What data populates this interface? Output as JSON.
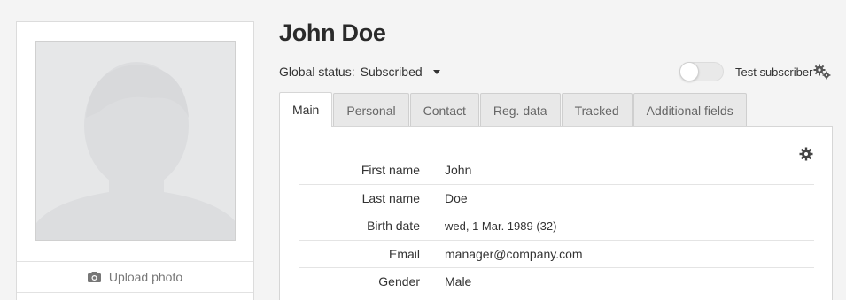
{
  "profile": {
    "name": "John Doe",
    "upload_label": "Upload photo"
  },
  "status": {
    "label": "Global status:",
    "value": "Subscribed"
  },
  "test_subscriber": {
    "label": "Test subscriber",
    "enabled": false
  },
  "tabs": [
    {
      "label": "Main",
      "active": true
    },
    {
      "label": "Personal",
      "active": false
    },
    {
      "label": "Contact",
      "active": false
    },
    {
      "label": "Reg. data",
      "active": false
    },
    {
      "label": "Tracked",
      "active": false
    },
    {
      "label": "Additional fields",
      "active": false
    }
  ],
  "fields": [
    {
      "label": "First name",
      "value": "John"
    },
    {
      "label": "Last name",
      "value": "Doe"
    },
    {
      "label": "Birth date",
      "value": "wed, 1 Mar. 1989 (32)"
    },
    {
      "label": "Email",
      "value": "manager@company.com"
    },
    {
      "label": "Gender",
      "value": "Male"
    }
  ],
  "icons": {
    "upload": "camera-icon",
    "settings": "gears-icon",
    "panel_settings": "gear-icon",
    "status_dropdown": "caret-down-icon"
  },
  "colors": {
    "background": "#f4f4f4",
    "card": "#ffffff",
    "tab_inactive": "#e8e8e8",
    "avatar_placeholder": "#e7e8e9"
  }
}
